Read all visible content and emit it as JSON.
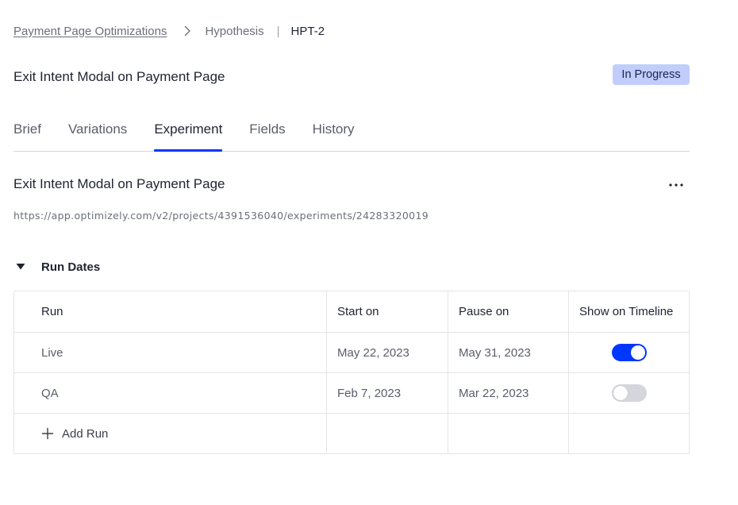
{
  "breadcrumb": {
    "project": "Payment Page Optimizations",
    "section": "Hypothesis",
    "current": "HPT-2"
  },
  "header": {
    "title": "Exit Intent Modal on Payment Page",
    "status": "In Progress"
  },
  "tabs": [
    {
      "label": "Brief",
      "active": false
    },
    {
      "label": "Variations",
      "active": false
    },
    {
      "label": "Experiment",
      "active": true
    },
    {
      "label": "Fields",
      "active": false
    },
    {
      "label": "History",
      "active": false
    }
  ],
  "experiment": {
    "title": "Exit Intent Modal on Payment Page",
    "url": "https://app.optimizely.com/v2/projects/4391536040/experiments/24283320019"
  },
  "run_dates": {
    "section_title": "Run Dates",
    "columns": {
      "run": "Run",
      "start": "Start on",
      "pause": "Pause on",
      "show": "Show on Timeline"
    },
    "rows": [
      {
        "run": "Live",
        "start": "May 22, 2023",
        "pause": "May 31, 2023",
        "show": true
      },
      {
        "run": "QA",
        "start": "Feb 7, 2023",
        "pause": "Mar 22, 2023",
        "show": false
      }
    ],
    "add_label": "Add Run"
  },
  "colors": {
    "accent": "#0037ff",
    "badge_bg": "#c2cdfc",
    "toggle_off": "#d4d6db"
  },
  "icons": {
    "breadcrumb_separator": "chevron-right-icon",
    "more": "more-horizontal-icon",
    "collapse": "triangle-down-icon",
    "add": "plus-icon"
  }
}
